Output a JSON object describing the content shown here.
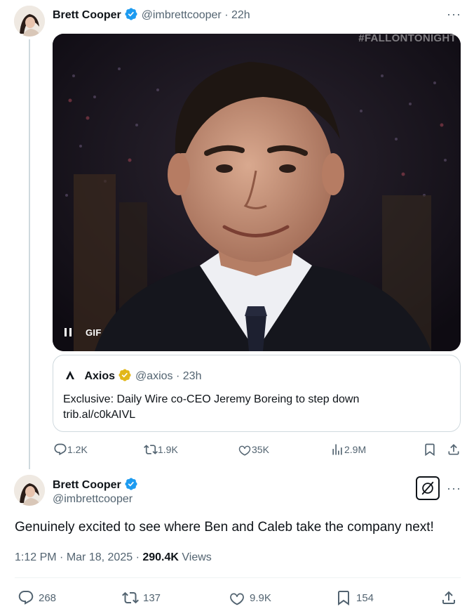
{
  "quoted_tweet_author": {
    "name": "Brett Cooper",
    "handle": "@imbrettcooper",
    "time": "22h"
  },
  "media": {
    "watermark": "#FALLONTONIGHT",
    "pause_icon": "pause-icon",
    "gif_label": "GIF"
  },
  "quote": {
    "name": "Axios",
    "handle": "@axios",
    "time": "23h",
    "text": "Exclusive: Daily Wire co-CEO Jeremy Boreing to step down",
    "link": "trib.al/c0kAIVL"
  },
  "tweet1_actions": {
    "replies": "1.2K",
    "reposts": "1.9K",
    "likes": "35K",
    "views": "2.9M"
  },
  "main_tweet": {
    "name": "Brett Cooper",
    "handle": "@imbrettcooper",
    "text": "Genuinely excited to see where Ben and Caleb take the company next!",
    "time": "1:12 PM",
    "date": "Mar 18, 2025",
    "views_count": "290.4K",
    "views_label": "Views",
    "replies": "268",
    "reposts": "137",
    "likes": "9.9K",
    "bookmarks": "154"
  },
  "colors": {
    "verified_blue": "#1d9bf0",
    "verified_gold": "#e2b719",
    "secondary_text": "#536471",
    "border": "#cfd9de"
  }
}
